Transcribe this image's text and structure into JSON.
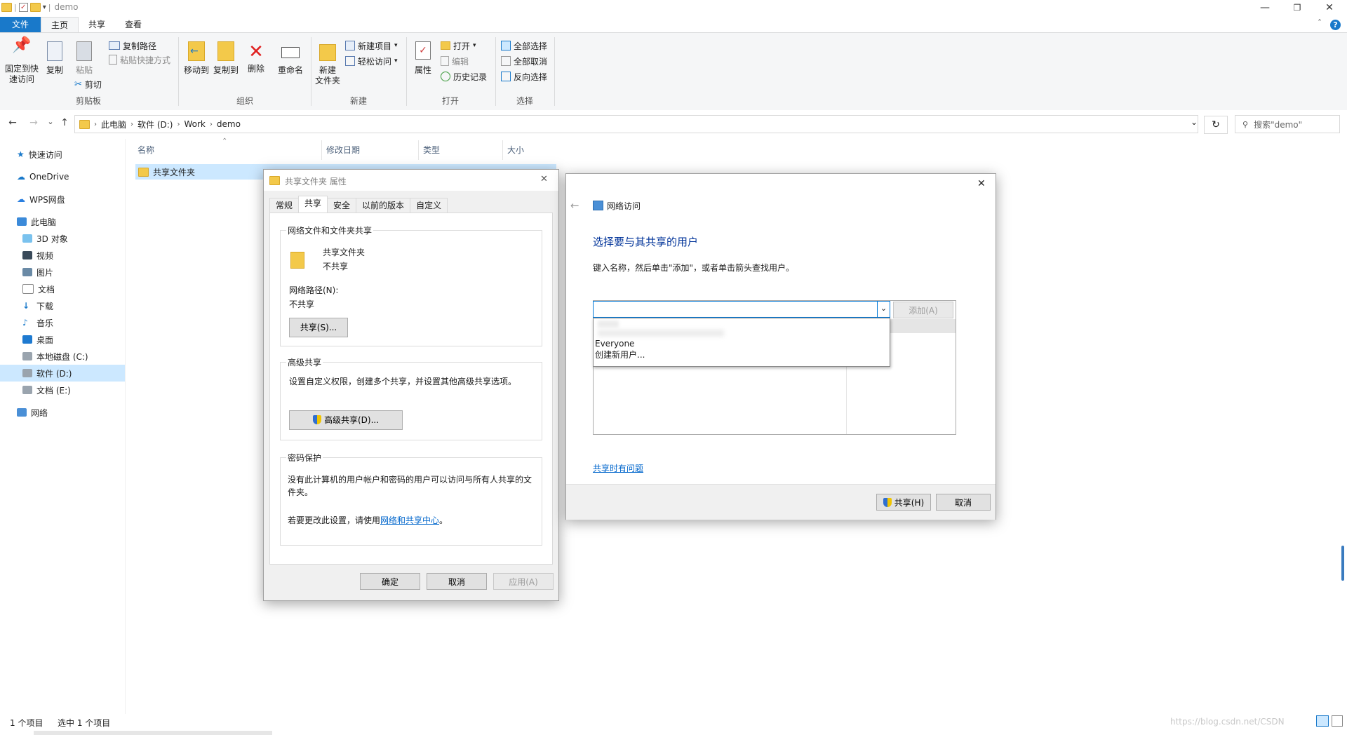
{
  "window": {
    "title": "demo",
    "qat_sep": "|",
    "qat_arrow": "▾",
    "min": "—",
    "max": "❐",
    "close": "✕",
    "ribbon_collapse": "ˆ",
    "help": "?"
  },
  "ribbon_tabs": [
    "文件",
    "主页",
    "共享",
    "查看"
  ],
  "ribbon": {
    "clipboard": {
      "pin": "固定到快\n速访问",
      "copy": "复制",
      "paste": "粘贴",
      "copy_path": "复制路径",
      "paste_shortcut": "粘贴快捷方式",
      "cut": "剪切",
      "label": "剪贴板"
    },
    "organize": {
      "move_to": "移动到",
      "copy_to": "复制到",
      "delete": "删除",
      "rename": "重命名",
      "label": "组织"
    },
    "new": {
      "new_folder": "新建\n文件夹",
      "new_item": "新建项目",
      "easy_access": "轻松访问",
      "label": "新建"
    },
    "open": {
      "properties": "属性",
      "open": "打开",
      "edit": "编辑",
      "history": "历史记录",
      "label": "打开"
    },
    "select": {
      "select_all": "全部选择",
      "select_none": "全部取消",
      "invert": "反向选择",
      "label": "选择"
    }
  },
  "address": {
    "back": "←",
    "forward": "→",
    "recent": "⌄",
    "up": "↑",
    "crumbs": [
      "此电脑",
      "软件 (D:)",
      "Work",
      "demo"
    ],
    "dropdown": "⌄",
    "refresh": "↻",
    "search_placeholder": "搜索\"demo\""
  },
  "nav": {
    "quick_access": "快速访问",
    "onedrive": "OneDrive",
    "wps": "WPS网盘",
    "this_pc": "此电脑",
    "items": [
      "3D 对象",
      "视频",
      "图片",
      "文档",
      "下载",
      "音乐",
      "桌面",
      "本地磁盘 (C:)",
      "软件 (D:)",
      "文档 (E:)"
    ],
    "network": "网络"
  },
  "file_list": {
    "columns": [
      "名称",
      "修改日期",
      "类型",
      "大小"
    ],
    "rows": [
      {
        "name": "共享文件夹"
      }
    ]
  },
  "status": {
    "count": "1 个项目",
    "selected": "选中 1 个项目",
    "watermark": "https://blog.csdn.net/CSDN"
  },
  "props_dialog": {
    "title": "共享文件夹 属性",
    "close": "✕",
    "tabs": [
      "常规",
      "共享",
      "安全",
      "以前的版本",
      "自定义"
    ],
    "net_share_title": "网络文件和文件夹共享",
    "folder_name": "共享文件夹",
    "share_state": "不共享",
    "net_path_label": "网络路径(N):",
    "net_path_value": "不共享",
    "share_btn": "共享(S)...",
    "adv_title": "高级共享",
    "adv_desc": "设置自定义权限，创建多个共享，并设置其他高级共享选项。",
    "adv_btn": "高级共享(D)...",
    "pwd_title": "密码保护",
    "pwd_desc": "没有此计算机的用户帐户和密码的用户可以访问与所有人共享的文件夹。",
    "pwd_change_prefix": "若要更改此设置，请使用",
    "pwd_link": "网络和共享中心",
    "pwd_change_suffix": "。",
    "ok": "确定",
    "cancel": "取消",
    "apply": "应用(A)"
  },
  "net_dialog": {
    "close": "✕",
    "back": "←",
    "title": "网络访问",
    "heading": "选择要与其共享的用户",
    "instruction": "键入名称，然后单击\"添加\"，或者单击箭头查找用户。",
    "input_value": "",
    "combo_arrow": "⌄",
    "add_btn": "添加(A)",
    "dropdown_options": [
      "Everyone",
      "创建新用户..."
    ],
    "problem_link": "共享时有问题",
    "share_btn": "共享(H)",
    "cancel_btn": "取消"
  }
}
